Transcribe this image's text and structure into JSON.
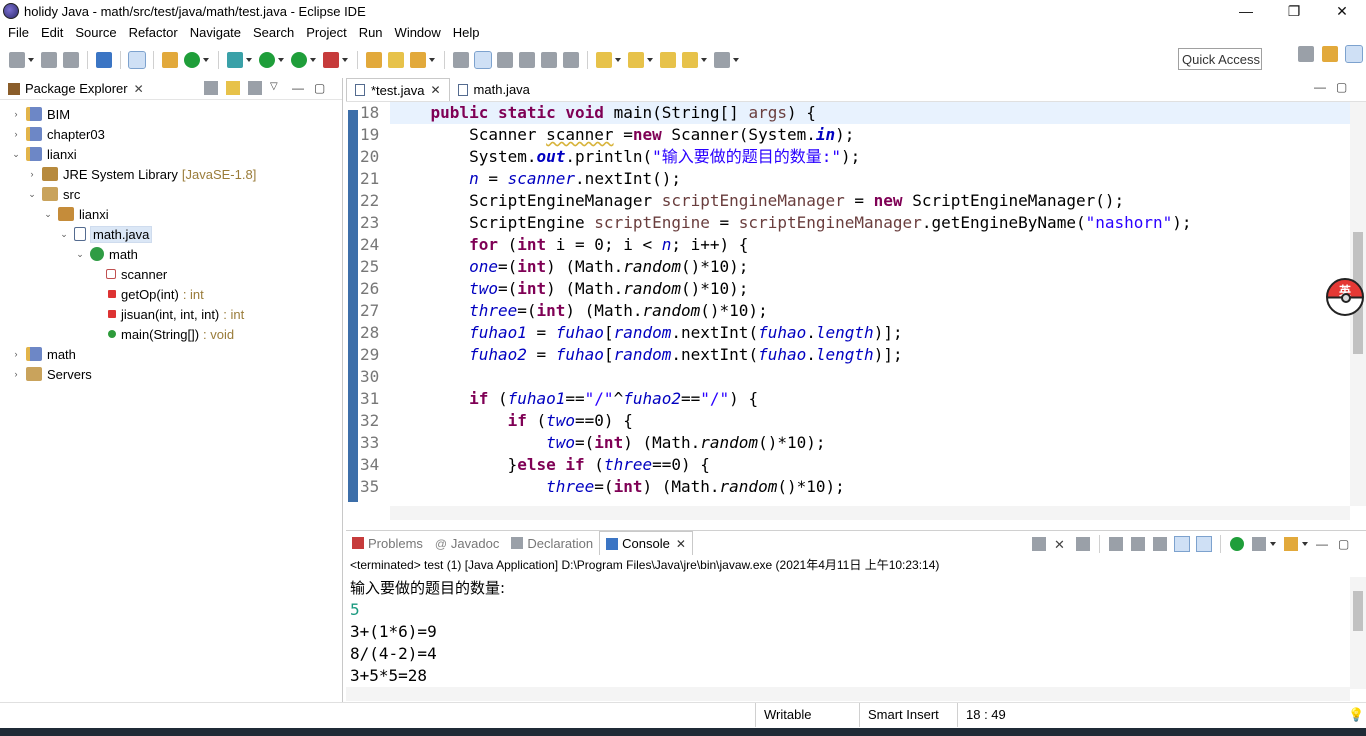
{
  "window": {
    "title": "holidy Java - math/src/test/java/math/test.java - Eclipse IDE",
    "buttons": [
      "—",
      "❐",
      "✕"
    ]
  },
  "menu": [
    "File",
    "Edit",
    "Source",
    "Refactor",
    "Navigate",
    "Search",
    "Project",
    "Run",
    "Window",
    "Help"
  ],
  "toolbar": {
    "quick_access": "Quick Access"
  },
  "package_explorer": {
    "title": "Package Explorer",
    "tree": [
      {
        "label": "BIM",
        "indent": 0,
        "twisty": "›",
        "icon": "project-icon"
      },
      {
        "label": "chapter03",
        "indent": 0,
        "twisty": "›",
        "icon": "project-icon"
      },
      {
        "label": "lianxi",
        "indent": 0,
        "twisty": "⌄",
        "icon": "project-icon"
      },
      {
        "label": "JRE System Library",
        "suffix": "[JavaSE-1.8]",
        "indent": 1,
        "twisty": "›",
        "icon": "library-icon"
      },
      {
        "label": "src",
        "indent": 1,
        "twisty": "⌄",
        "icon": "source-folder-icon"
      },
      {
        "label": "lianxi",
        "indent": 2,
        "twisty": "⌄",
        "icon": "package-icon"
      },
      {
        "label": "math.java",
        "indent": 3,
        "twisty": "⌄",
        "icon": "java-file-icon",
        "selected": true
      },
      {
        "label": "math",
        "indent": 4,
        "twisty": "⌄",
        "icon": "class-icon"
      },
      {
        "label": "scanner",
        "indent": 5,
        "twisty": "",
        "icon": "field-icon"
      },
      {
        "label": "getOp(int)",
        "suffix": ": int",
        "indent": 5,
        "twisty": "",
        "icon": "method-icon"
      },
      {
        "label": "jisuan(int, int, int)",
        "suffix": ": int",
        "indent": 5,
        "twisty": "",
        "icon": "method-icon"
      },
      {
        "label": "main(String[])",
        "suffix": ": void",
        "indent": 5,
        "twisty": "",
        "icon": "public-method-icon"
      },
      {
        "label": "math",
        "indent": 0,
        "twisty": "›",
        "icon": "project-icon"
      },
      {
        "label": "Servers",
        "indent": 0,
        "twisty": "›",
        "icon": "folder-icon"
      }
    ]
  },
  "editor": {
    "tabs": [
      {
        "label": "*test.java",
        "active": true
      },
      {
        "label": "math.java",
        "active": false
      }
    ],
    "line_numbers": [
      "18",
      "19",
      "20",
      "21",
      "22",
      "23",
      "24",
      "25",
      "26",
      "27",
      "28",
      "29",
      "30",
      "31",
      "32",
      "33",
      "34",
      "35"
    ],
    "current_line_index": 0,
    "lines": [
      [
        [
          "",
          "    "
        ],
        [
          "kw",
          "public"
        ],
        [
          "",
          " "
        ],
        [
          "kw",
          "static"
        ],
        [
          "",
          " "
        ],
        [
          "kw",
          "void"
        ],
        [
          "",
          " main(String[] "
        ],
        [
          "loc",
          "args"
        ],
        [
          "",
          ") {"
        ]
      ],
      [
        [
          "",
          "        Scanner "
        ],
        [
          "warn",
          "scanner"
        ],
        [
          "",
          " ="
        ],
        [
          "kw",
          "new"
        ],
        [
          "",
          " Scanner(System."
        ],
        [
          "sfld",
          "in"
        ],
        [
          "",
          ");"
        ]
      ],
      [
        [
          "",
          "        System."
        ],
        [
          "sfld",
          "out"
        ],
        [
          "",
          ".println("
        ],
        [
          "str",
          "\"输入要做的题目的数量:\""
        ],
        [
          "",
          ");"
        ]
      ],
      [
        [
          "",
          "        "
        ],
        [
          "fld",
          "n"
        ],
        [
          "",
          " = "
        ],
        [
          "fld",
          "scanner"
        ],
        [
          "",
          ".nextInt();"
        ]
      ],
      [
        [
          "",
          "        ScriptEngineManager "
        ],
        [
          "loc",
          "scriptEngineManager"
        ],
        [
          "",
          " = "
        ],
        [
          "kw",
          "new"
        ],
        [
          "",
          " ScriptEngineManager();"
        ]
      ],
      [
        [
          "",
          "        ScriptEngine "
        ],
        [
          "loc",
          "scriptEngine"
        ],
        [
          "",
          " = "
        ],
        [
          "loc",
          "scriptEngineManager"
        ],
        [
          "",
          ".getEngineByName("
        ],
        [
          "str",
          "\"nashorn\""
        ],
        [
          "",
          ");"
        ]
      ],
      [
        [
          "",
          "        "
        ],
        [
          "kw",
          "for"
        ],
        [
          "",
          " ("
        ],
        [
          "kw",
          "int"
        ],
        [
          "",
          " i = 0; i < "
        ],
        [
          "fld",
          "n"
        ],
        [
          "",
          "; i++) {"
        ]
      ],
      [
        [
          "",
          "        "
        ],
        [
          "fld",
          "one"
        ],
        [
          "",
          "=("
        ],
        [
          "kw",
          "int"
        ],
        [
          "",
          ") (Math."
        ],
        [
          "it",
          "random"
        ],
        [
          "",
          "()*10);"
        ]
      ],
      [
        [
          "",
          "        "
        ],
        [
          "fld",
          "two"
        ],
        [
          "",
          "=("
        ],
        [
          "kw",
          "int"
        ],
        [
          "",
          ") (Math."
        ],
        [
          "it",
          "random"
        ],
        [
          "",
          "()*10);"
        ]
      ],
      [
        [
          "",
          "        "
        ],
        [
          "fld",
          "three"
        ],
        [
          "",
          "=("
        ],
        [
          "kw",
          "int"
        ],
        [
          "",
          ") (Math."
        ],
        [
          "it",
          "random"
        ],
        [
          "",
          "()*10);"
        ]
      ],
      [
        [
          "",
          "        "
        ],
        [
          "fld",
          "fuhao1"
        ],
        [
          "",
          " = "
        ],
        [
          "fld",
          "fuhao"
        ],
        [
          "",
          "["
        ],
        [
          "fld",
          "random"
        ],
        [
          "",
          ".nextInt("
        ],
        [
          "fld",
          "fuhao"
        ],
        [
          "",
          "."
        ],
        [
          "fld",
          "length"
        ],
        [
          "",
          ")];"
        ]
      ],
      [
        [
          "",
          "        "
        ],
        [
          "fld",
          "fuhao2"
        ],
        [
          "",
          " = "
        ],
        [
          "fld",
          "fuhao"
        ],
        [
          "",
          "["
        ],
        [
          "fld",
          "random"
        ],
        [
          "",
          ".nextInt("
        ],
        [
          "fld",
          "fuhao"
        ],
        [
          "",
          "."
        ],
        [
          "fld",
          "length"
        ],
        [
          "",
          ")];"
        ]
      ],
      [
        [
          "",
          ""
        ]
      ],
      [
        [
          "",
          "        "
        ],
        [
          "kw",
          "if"
        ],
        [
          "",
          " ("
        ],
        [
          "fld",
          "fuhao1"
        ],
        [
          "",
          "=="
        ],
        [
          "str",
          "\"/\""
        ],
        [
          "",
          "^"
        ],
        [
          "fld",
          "fuhao2"
        ],
        [
          "",
          "=="
        ],
        [
          "str",
          "\"/\""
        ],
        [
          "",
          ") {"
        ]
      ],
      [
        [
          "",
          "            "
        ],
        [
          "kw",
          "if"
        ],
        [
          "",
          " ("
        ],
        [
          "fld",
          "two"
        ],
        [
          "",
          "==0) {"
        ]
      ],
      [
        [
          "",
          "                "
        ],
        [
          "fld",
          "two"
        ],
        [
          "",
          "=("
        ],
        [
          "kw",
          "int"
        ],
        [
          "",
          ") (Math."
        ],
        [
          "it",
          "random"
        ],
        [
          "",
          "()*10);"
        ]
      ],
      [
        [
          "",
          "            }"
        ],
        [
          "kw",
          "else"
        ],
        [
          "",
          " "
        ],
        [
          "kw",
          "if"
        ],
        [
          "",
          " ("
        ],
        [
          "fld",
          "three"
        ],
        [
          "",
          "==0) {"
        ]
      ],
      [
        [
          "",
          "                "
        ],
        [
          "fld",
          "three"
        ],
        [
          "",
          "=("
        ],
        [
          "kw",
          "int"
        ],
        [
          "",
          ") (Math."
        ],
        [
          "it",
          "random"
        ],
        [
          "",
          "()*10);"
        ]
      ]
    ]
  },
  "console": {
    "tabs": [
      {
        "label": "Problems",
        "active": false,
        "icon": "problems-icon"
      },
      {
        "label": "Javadoc",
        "active": false,
        "icon": "javadoc-icon"
      },
      {
        "label": "Declaration",
        "active": false,
        "icon": "declaration-icon"
      },
      {
        "label": "Console",
        "active": true,
        "icon": "console-icon"
      }
    ],
    "status": "<terminated> test (1) [Java Application] D:\\Program Files\\Java\\jre\\bin\\javaw.exe (2021年4月11日 上午10:23:14)",
    "output": [
      {
        "text": "输入要做的题目的数量:",
        "kind": "cjk"
      },
      {
        "text": "5",
        "kind": "input"
      },
      {
        "text": "3+(1*6)=9",
        "kind": "normal"
      },
      {
        "text": "8/(4-2)=4",
        "kind": "normal"
      },
      {
        "text": "3+5*5=28",
        "kind": "normal"
      }
    ]
  },
  "statusbar": {
    "writable": "Writable",
    "insert_mode": "Smart Insert",
    "position": "18 : 49"
  },
  "ime": {
    "label": "英"
  }
}
